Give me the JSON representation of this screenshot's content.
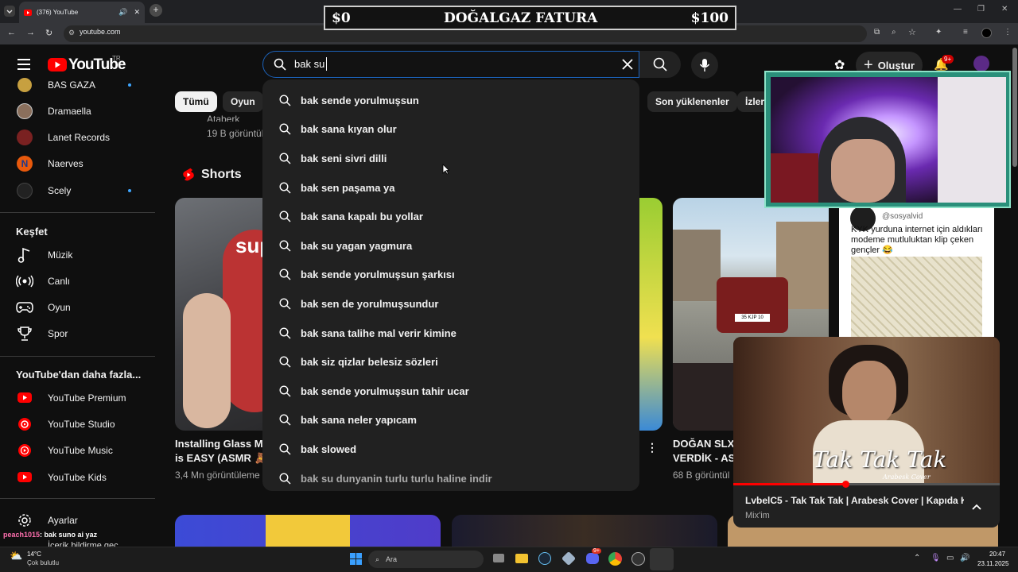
{
  "browser": {
    "tab_title": "(376) YouTube",
    "url": "youtube.com"
  },
  "overlay": {
    "left": "$0",
    "center": "DOĞALGAZ FATURA",
    "right": "$100"
  },
  "header": {
    "logo_text": "YouTube",
    "logo_region": "TR",
    "search_value": "bak su",
    "create_label": "Oluştur",
    "notifications_badge": "9+"
  },
  "sidebar": {
    "subscriptions": [
      {
        "label": "BAS GAZA",
        "dot": true
      },
      {
        "label": "Dramaella",
        "dot": false
      },
      {
        "label": "Lanet Records",
        "dot": false
      },
      {
        "label": "Naerves",
        "dot": false
      },
      {
        "label": "Scely",
        "dot": true
      }
    ],
    "explore_title": "Keşfet",
    "explore": [
      {
        "label": "Müzik",
        "icon": "music-icon"
      },
      {
        "label": "Canlı",
        "icon": "live-icon"
      },
      {
        "label": "Oyun",
        "icon": "gaming-icon"
      },
      {
        "label": "Spor",
        "icon": "trophy-icon"
      }
    ],
    "more_title": "YouTube'dan daha fazla...",
    "more": [
      {
        "label": "YouTube Premium"
      },
      {
        "label": "YouTube Studio"
      },
      {
        "label": "YouTube Music"
      },
      {
        "label": "YouTube Kids"
      }
    ],
    "settings_label": "Ayarlar",
    "cut_label": "İçerik bildirme geç"
  },
  "chips": [
    "Tümü",
    "Oyun",
    "Son yüklenenler",
    "İzler"
  ],
  "content": {
    "top_meta_1": "Ataberk Doğa",
    "top_meta_2": "19 B görüntül",
    "shorts_title": "Shorts",
    "short1_title_1": "Installing Glass Mo",
    "short1_title_2": "is EASY (ASMR 🧸",
    "short1_views": "3,4 Mn görüntüleme",
    "short2_title_1": "DOĞAN SLX I",
    "short2_title_2": "VERDİK - ASS",
    "short2_views": "68 B görüntül",
    "tweet_handle": "@sosyalvid",
    "tweet_text": "KYK yurduna internet için aldıkları modeme mutluluktan klip çeken gençler 😂",
    "car_plate": "35 KJP 10"
  },
  "suggestions": [
    "bak sende yorulmuşsun",
    "bak sana kıyan olur",
    "bak seni sivri dilli",
    "bak sen paşama ya",
    "bak sana kapalı bu yollar",
    "bak su yagan yagmura",
    "bak sende yorulmuşsun şarkısı",
    "bak sen de yorulmuşsundur",
    "bak sana talihe mal verir kimine",
    "bak siz qizlar belesiz sözleri",
    "bak sende yorulmuşsun tahir ucar",
    "bak sana neler yapıcam",
    "bak slowed",
    "bak su dunyanin turlu turlu haline indir"
  ],
  "miniplayer": {
    "art_title": "Tak Tak Tak",
    "art_subtitle": "Arabesk Cover",
    "title": "LvbelC5 - Tak Tak Tak | Arabesk Cover | Kapıda Ki...",
    "channel": "Mix'im",
    "progress": 0.42
  },
  "chat": {
    "user": "peach1015",
    "message": ": bak suno ai yaz"
  },
  "taskbar": {
    "weather_temp": "14°C",
    "weather_desc": "Çok bulutlu",
    "search_label": "Ara",
    "discord_badge": "9+",
    "time": "20:47",
    "date": "23.11.2025"
  },
  "colors": {
    "bg": "#0f0f0f",
    "accent_red": "#ff0000",
    "search_border": "#1c62b9",
    "dropdown_bg": "#212121"
  }
}
